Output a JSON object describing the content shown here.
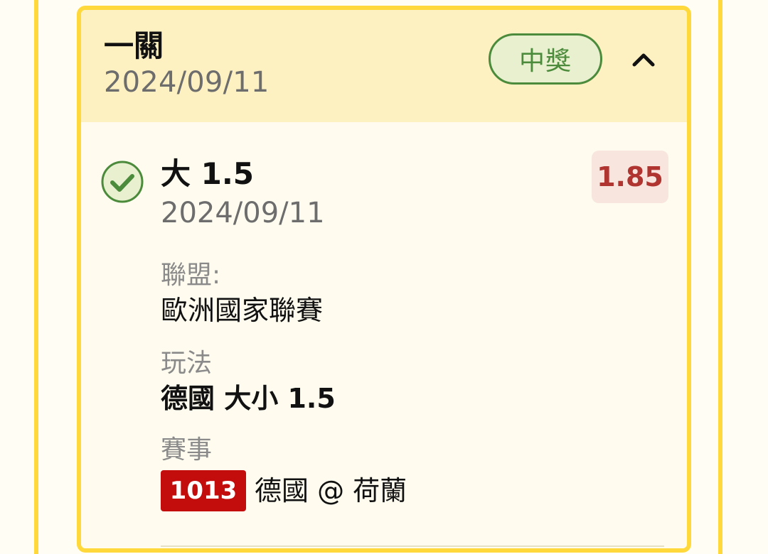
{
  "bet_card": {
    "title": "一關",
    "date": "2024/09/11",
    "status_label": "中獎",
    "expanded": true,
    "colors": {
      "frame": "#ffd93b",
      "header_bg": "#fdf0c1",
      "win_green": "#4b8b3b",
      "odds_red": "#b03430",
      "match_red": "#c30d0d"
    }
  },
  "selection": {
    "name": "大 1.5",
    "date": "2024/09/11",
    "odds": "1.85",
    "result_icon": "check-circle-icon"
  },
  "details": {
    "league_label": "聯盟:",
    "league_value": "歐洲國家聯賽",
    "playtype_label": "玩法",
    "playtype_value": "德國 大小 1.5",
    "match_label": "賽事",
    "match_number": "1013",
    "match_teams": "德國 @ 荷蘭"
  },
  "icons": {
    "collapse": "chevron-up-icon"
  }
}
